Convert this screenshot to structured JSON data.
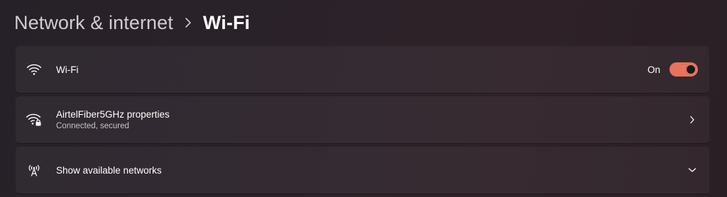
{
  "breadcrumb": {
    "parent": "Network & internet",
    "current": "Wi-Fi"
  },
  "wifi_toggle": {
    "label": "Wi-Fi",
    "state_label": "On",
    "enabled": true,
    "icon": "wifi-icon"
  },
  "network_properties": {
    "title": "AirtelFiber5GHz properties",
    "status": "Connected, secured",
    "icon": "wifi-secured-icon"
  },
  "available_networks": {
    "label": "Show available networks",
    "icon": "antenna-icon"
  },
  "colors": {
    "accent": "#e6735e"
  }
}
